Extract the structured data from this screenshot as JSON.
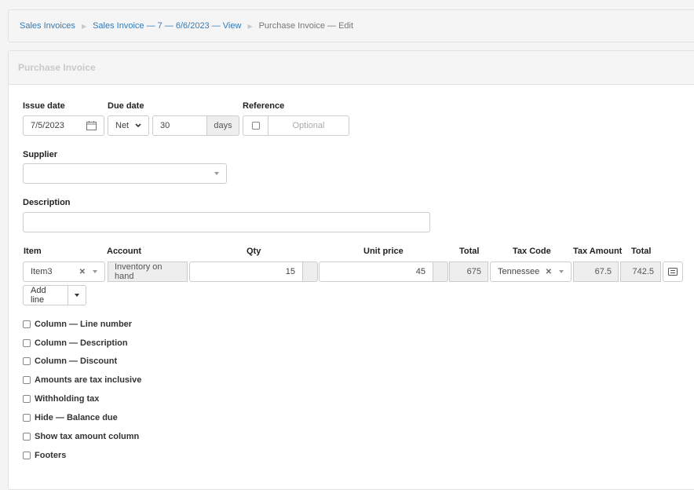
{
  "breadcrumb": {
    "items": [
      "Sales Invoices",
      "Sales Invoice — 7 — 6/6/2023 — View"
    ],
    "current": "Purchase Invoice — Edit"
  },
  "panel": {
    "title": "Purchase Invoice"
  },
  "form": {
    "issue_date_label": "Issue date",
    "issue_date_value": "7/5/2023",
    "due_date_label": "Due date",
    "due_type": "Net",
    "due_days": "30",
    "days_label": "days",
    "reference_label": "Reference",
    "reference_placeholder": "Optional",
    "supplier_label": "Supplier",
    "supplier_value": "",
    "description_label": "Description",
    "description_value": ""
  },
  "lines": {
    "headers": {
      "item": "Item",
      "account": "Account",
      "qty": "Qty",
      "unit_price": "Unit price",
      "total": "Total",
      "tax_code": "Tax Code",
      "tax_amount": "Tax Amount",
      "grand_total": "Total"
    },
    "rows": [
      {
        "item": "Item3",
        "account": "Inventory on hand",
        "qty": "15",
        "unit_price": "45",
        "total": "675",
        "tax_code": "Tennessee",
        "tax_amount": "67.5",
        "grand_total": "742.5"
      }
    ],
    "add_line_label": "Add line"
  },
  "options": [
    {
      "label": "Column — Line number",
      "checked": false
    },
    {
      "label": "Column — Description",
      "checked": false
    },
    {
      "label": "Column — Discount",
      "checked": false
    },
    {
      "label": "Amounts are tax inclusive",
      "checked": false
    },
    {
      "label": "Withholding tax",
      "checked": false
    },
    {
      "label": "Hide — Balance due",
      "checked": false
    },
    {
      "label": "Show tax amount column",
      "checked": false
    },
    {
      "label": "Footers",
      "checked": false
    }
  ],
  "colors": {
    "link": "#337ab7",
    "header_bg": "#f5f5f5",
    "border": "#cccccc"
  }
}
